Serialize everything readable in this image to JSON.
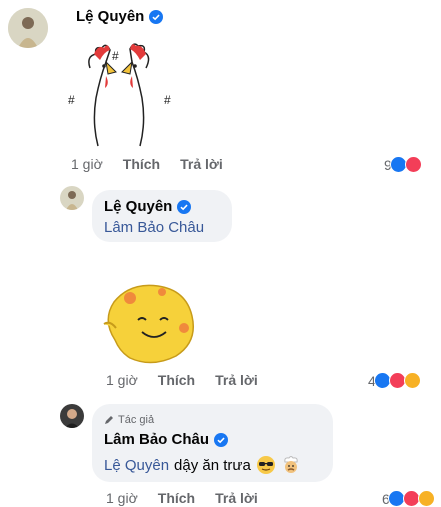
{
  "colors": {
    "verified": "#1877f2",
    "link": "#385898",
    "meta": "#65676b",
    "bubble": "#f0f2f5",
    "like": "#1877f2",
    "love": "#f33e58",
    "haha": "#f7b125",
    "sticker_yellow": "#f6d13a",
    "sticker_orange": "#f08a3c"
  },
  "comments": [
    {
      "author": "Lệ Quyên",
      "time": "1 giờ",
      "like_label": "Thích",
      "reply_label": "Trả lời",
      "reaction_count": "9",
      "reactions": [
        "like-icon",
        "love-icon"
      ],
      "sticker": "rooster-sticker"
    },
    {
      "author": "Lệ Quyên",
      "mention": "Lâm Bảo Châu",
      "time": "1 giờ",
      "like_label": "Thích",
      "reply_label": "Trả lời",
      "reaction_count": "4",
      "reactions": [
        "like-icon",
        "love-icon",
        "haha-icon"
      ],
      "sticker": "blob-sticker"
    },
    {
      "badge": "Tác giả",
      "author": "Lâm Bảo Châu",
      "mention": "Lệ Quyên",
      "text": "dậy ăn trưa",
      "time": "1 giờ",
      "like_label": "Thích",
      "reply_label": "Trả lời",
      "reaction_count": "6",
      "reactions": [
        "like-icon",
        "love-icon",
        "haha-icon"
      ],
      "emoji": [
        "sunglasses-emoji",
        "chef-emoji"
      ]
    }
  ]
}
